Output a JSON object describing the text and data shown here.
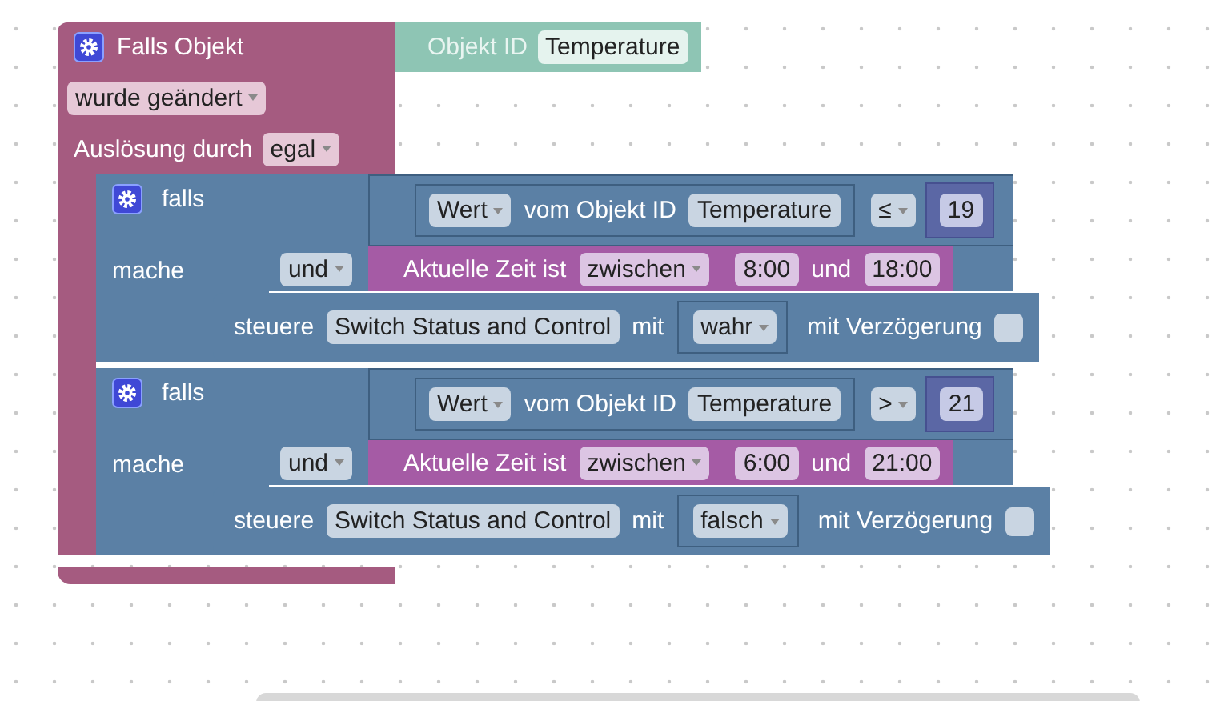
{
  "trigger": {
    "title": "Falls Objekt",
    "object_label": "Objekt ID",
    "object_value": "Temperature",
    "change_mode": "wurde geändert",
    "source_label": "Auslösung durch",
    "source_value": "egal"
  },
  "rules": [
    {
      "if_label": "falls",
      "compare": {
        "mode": "Wert",
        "label": "vom Objekt ID",
        "object": "Temperature",
        "operator": "≤",
        "value": "19"
      },
      "logic": "und",
      "time": {
        "label": "Aktuelle Zeit ist",
        "mode": "zwischen",
        "start": "8:00",
        "joiner": "und",
        "end": "18:00"
      },
      "do_label": "mache",
      "action": {
        "label": "steuere",
        "device": "Switch Status and Control",
        "with_label": "mit",
        "value": "wahr",
        "delay_label": "mit Verzögerung",
        "delay_checked": false
      }
    },
    {
      "if_label": "falls",
      "compare": {
        "mode": "Wert",
        "label": "vom Objekt ID",
        "object": "Temperature",
        "operator": ">",
        "value": "21"
      },
      "logic": "und",
      "time": {
        "label": "Aktuelle Zeit ist",
        "mode": "zwischen",
        "start": "6:00",
        "joiner": "und",
        "end": "21:00"
      },
      "do_label": "mache",
      "action": {
        "label": "steuere",
        "device": "Switch Status and Control",
        "with_label": "mit",
        "value": "falsch",
        "delay_label": "mit Verzögerung",
        "delay_checked": false
      }
    }
  ]
}
